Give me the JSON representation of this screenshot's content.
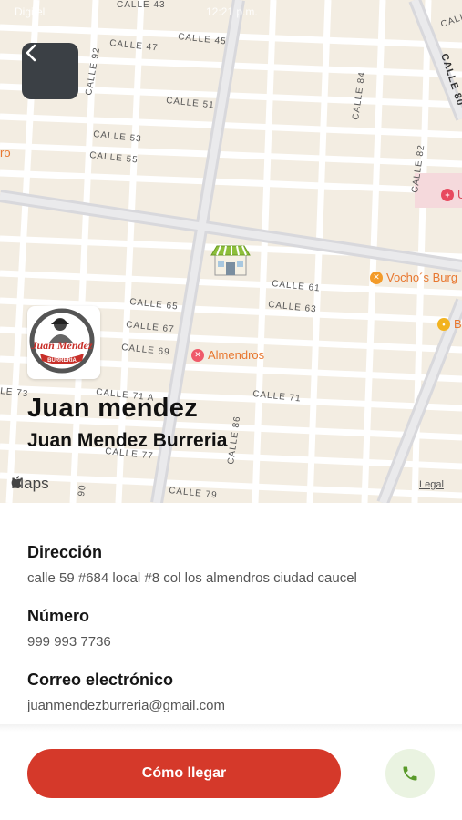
{
  "status_bar": {
    "carrier": "Digitel",
    "time": "12:21 p.m."
  },
  "map": {
    "streets": {
      "calle_43": "CALLE 43",
      "calle_45": "CALLE 45",
      "calle_47": "CALLE 47",
      "calle_92": "CALLE 92",
      "calle_84": "CALLE 84",
      "calle_80": "CALLE 80",
      "calle_51": "CALLE 51",
      "calle_53": "CALLE 53",
      "calle_55": "CALLE 55",
      "calle_82": "CALLE 82",
      "calle_61": "CALLE 61",
      "calle_63": "CALLE 63",
      "calle_65": "CALLE 65",
      "calle_67": "CALLE 67",
      "calle_69": "CALLE 69",
      "calle_71": "CALLE 71",
      "calle_71a": "CALLE 71 A",
      "calle_73": "LE 73",
      "calle_77": "CALLE 77",
      "calle_79": "CALLE 79",
      "calle_86": "CALLE 86",
      "calle_90": "90",
      "calle_edge": "CALL"
    },
    "pois": {
      "almendros": "Almendros",
      "vochos": "Vocho´s Burg",
      "hospital": "U",
      "b": "B",
      "ro": "ro"
    },
    "attribution": "Maps",
    "legal": "Legal"
  },
  "business": {
    "logo_text": "Juan Mendez",
    "logo_sub": "BURRERIA",
    "title": "Juan mendez",
    "subtitle": "Juan Mendez Burreria"
  },
  "info": {
    "address_label": "Dirección",
    "address_value": "calle 59 #684 local #8 col los almendros ciudad caucel",
    "phone_label": "Número",
    "phone_value": "999 993 7736",
    "email_label": "Correo electrónico",
    "email_value": "juanmendezburreria@gmail.com"
  },
  "actions": {
    "directions_label": "Cómo llegar"
  },
  "colors": {
    "accent": "#d5392a",
    "call_bg": "#eaf3e1",
    "call_icon": "#5a9a2a",
    "map_bg": "#f3ede2"
  },
  "icons": {
    "back": "chevron-left-icon",
    "call": "phone-icon",
    "store": "store-icon",
    "apple": "apple-icon"
  }
}
